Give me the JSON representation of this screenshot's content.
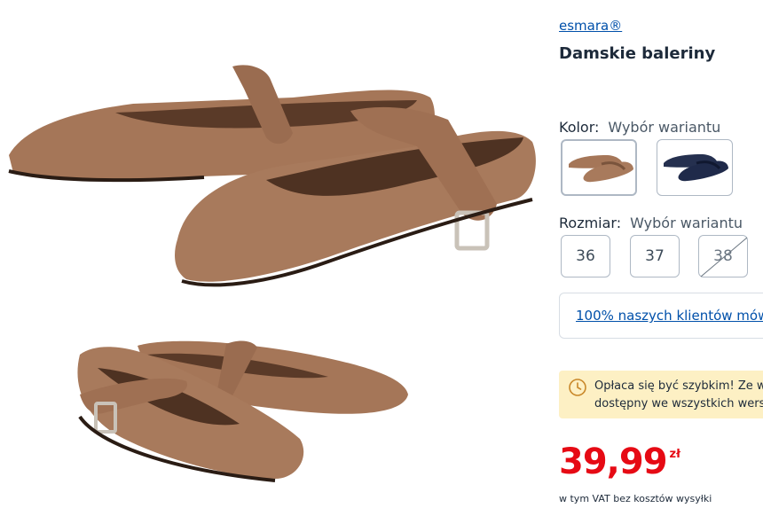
{
  "product": {
    "brand": "esmara®",
    "title": "Damskie baleriny"
  },
  "gallery": {
    "images": [
      {
        "name": "brown ballet flats pair top view",
        "color": "#9c6f52"
      },
      {
        "name": "brown ballet flats pair side view",
        "color": "#9c6f52"
      }
    ]
  },
  "options": {
    "color": {
      "label": "Kolor:",
      "value": "Wybór wariantu",
      "swatches": [
        {
          "name": "brown",
          "color": "#9c6f52",
          "selected": true
        },
        {
          "name": "navy",
          "color": "#1f2a4a",
          "selected": false
        }
      ]
    },
    "size": {
      "label": "Rozmiar:",
      "value": "Wybór wariantu",
      "sizes": [
        {
          "label": "36",
          "available": true
        },
        {
          "label": "37",
          "available": true
        },
        {
          "label": "38",
          "available": false
        }
      ]
    }
  },
  "reviews": {
    "link_text": "100% naszych klientów mów"
  },
  "notice": {
    "icon": "clock-icon",
    "line1": "Opłaca się być szybkim! Ze wz",
    "line2": "dostępny we wszystkich wersja"
  },
  "price": {
    "amount": "39,99",
    "currency": "zł",
    "vat_note": "w tym VAT bez kosztów wysyłki"
  },
  "colors": {
    "accent": "#0050aa",
    "price": "#e60a14",
    "notice_bg": "#fdf0c4"
  }
}
